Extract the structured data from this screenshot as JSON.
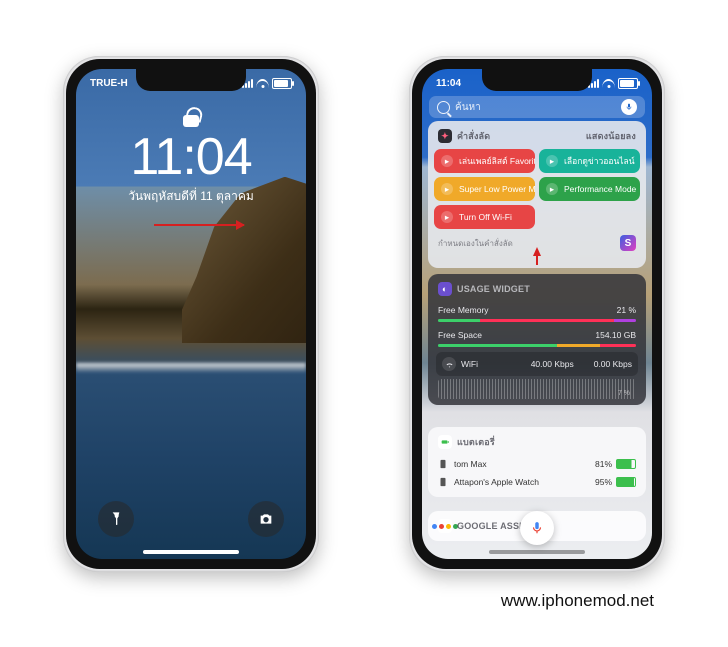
{
  "credit": "www.iphonemod.net",
  "left": {
    "carrier": "TRUE-H",
    "time": "11:04",
    "date": "วันพฤหัสบดีที่ 11 ตุลาคม"
  },
  "right": {
    "status_time": "11:04",
    "search_placeholder": "ค้นหา",
    "shortcuts": {
      "title": "คำสั่งลัด",
      "show_less": "แสดงน้อยลง",
      "tiles": [
        {
          "label": "เล่นเพลย์ลิสต์ Favorite...",
          "cls": "t-red"
        },
        {
          "label": "เลือกดูข่าวออนไลน์",
          "cls": "t-teal"
        },
        {
          "label": "Super Low Power M...",
          "cls": "t-yel"
        },
        {
          "label": "Performance Mode",
          "cls": "t-grn"
        },
        {
          "label": "Turn Off Wi-Fi",
          "cls": "t-red"
        }
      ],
      "create_hint": "กำหนดเองในคำสั่งลัด"
    },
    "usage": {
      "title": "USAGE WIDGET",
      "mem_label": "Free Memory",
      "mem_pct": "21 %",
      "space_label": "Free Space",
      "space_val": "154.10 GB",
      "wifi_label": "WiFi",
      "wifi_up": "40.00 Kbps",
      "wifi_down": "0.00 Kbps",
      "wave_pct": "7 %"
    },
    "batteries": {
      "title": "แบตเตอรี่",
      "items": [
        {
          "name": "tom Max",
          "pct": "81%",
          "fill": 81
        },
        {
          "name": "Attapon's Apple Watch",
          "pct": "95%",
          "fill": 95
        }
      ]
    },
    "ga_title": "GOOGLE ASSISTANT"
  }
}
